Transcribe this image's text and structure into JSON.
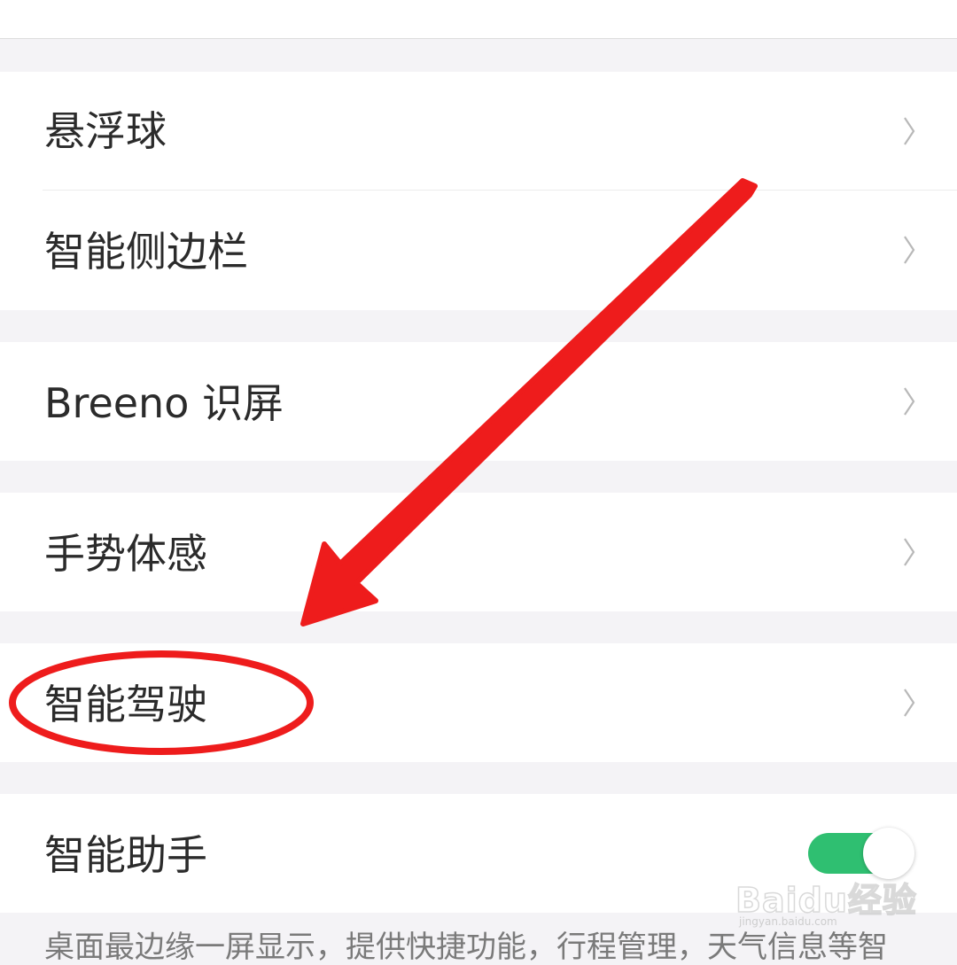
{
  "settings": {
    "items": [
      {
        "label": "悬浮球"
      },
      {
        "label": "智能侧边栏"
      },
      {
        "label": "Breeno 识屏"
      },
      {
        "label": "手势体感"
      },
      {
        "label": "智能驾驶"
      },
      {
        "label": "智能助手",
        "toggle_on": true
      }
    ],
    "assistant_description": "桌面最边缘一屏显示，提供快捷功能，行程管理，天气信息等智"
  },
  "colors": {
    "toggle_on": "#2fbf71",
    "annotation_red": "#ee1c1c",
    "page_background": "#f4f3f6"
  },
  "icons": {
    "chevron": "chevron-right-icon"
  },
  "watermark": {
    "brand": "Baidu经验",
    "url": "jingyan.baidu.com"
  }
}
